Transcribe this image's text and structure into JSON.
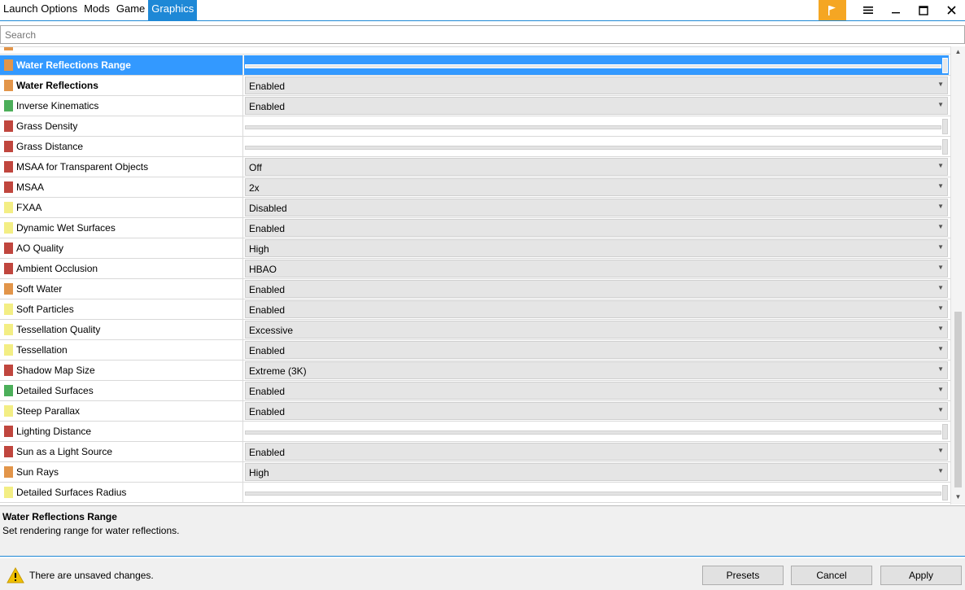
{
  "tabs": [
    {
      "label": "Launch Options",
      "active": false
    },
    {
      "label": "Mods",
      "active": false
    },
    {
      "label": "Game",
      "active": false
    },
    {
      "label": "Graphics",
      "active": true
    }
  ],
  "window_controls": [
    "flag-icon",
    "menu-icon",
    "minimize-icon",
    "maximize-icon",
    "close-icon"
  ],
  "search": {
    "placeholder": "Search",
    "value": ""
  },
  "colors": {
    "accent": "#1e88d6",
    "selected": "#3399ff",
    "flag": "#f5a623",
    "orange": "#e2954a",
    "green": "#4caf5a",
    "red": "#c0463e",
    "yellow": "#f3ee84"
  },
  "settings": [
    {
      "label": "Water Reflections Range",
      "color": "#e2954a",
      "type": "slider",
      "value": "",
      "selected": true,
      "bold": true
    },
    {
      "label": "Water Reflections",
      "color": "#e2954a",
      "type": "dropdown",
      "value": "Enabled",
      "bold": true
    },
    {
      "label": "Inverse Kinematics",
      "color": "#4caf5a",
      "type": "dropdown",
      "value": "Enabled"
    },
    {
      "label": "Grass Density",
      "color": "#c0463e",
      "type": "slider",
      "value": ""
    },
    {
      "label": "Grass Distance",
      "color": "#c0463e",
      "type": "slider",
      "value": ""
    },
    {
      "label": "MSAA for Transparent Objects",
      "color": "#c0463e",
      "type": "dropdown",
      "value": "Off"
    },
    {
      "label": "MSAA",
      "color": "#c0463e",
      "type": "dropdown",
      "value": "2x"
    },
    {
      "label": "FXAA",
      "color": "#f3ee84",
      "type": "dropdown",
      "value": "Disabled"
    },
    {
      "label": "Dynamic Wet Surfaces",
      "color": "#f3ee84",
      "type": "dropdown",
      "value": "Enabled"
    },
    {
      "label": "AO Quality",
      "color": "#c0463e",
      "type": "dropdown",
      "value": "High"
    },
    {
      "label": "Ambient Occlusion",
      "color": "#c0463e",
      "type": "dropdown",
      "value": "HBAO"
    },
    {
      "label": "Soft Water",
      "color": "#e2954a",
      "type": "dropdown",
      "value": "Enabled"
    },
    {
      "label": "Soft Particles",
      "color": "#f3ee84",
      "type": "dropdown",
      "value": "Enabled"
    },
    {
      "label": "Tessellation Quality",
      "color": "#f3ee84",
      "type": "dropdown",
      "value": "Excessive"
    },
    {
      "label": "Tessellation",
      "color": "#f3ee84",
      "type": "dropdown",
      "value": "Enabled"
    },
    {
      "label": "Shadow Map Size",
      "color": "#c0463e",
      "type": "dropdown",
      "value": "Extreme (3K)"
    },
    {
      "label": "Detailed Surfaces",
      "color": "#4caf5a",
      "type": "dropdown",
      "value": "Enabled"
    },
    {
      "label": "Steep Parallax",
      "color": "#f3ee84",
      "type": "dropdown",
      "value": "Enabled"
    },
    {
      "label": "Lighting Distance",
      "color": "#c0463e",
      "type": "slider",
      "value": ""
    },
    {
      "label": "Sun as a Light Source",
      "color": "#c0463e",
      "type": "dropdown",
      "value": "Enabled"
    },
    {
      "label": "Sun Rays",
      "color": "#e2954a",
      "type": "dropdown",
      "value": "High"
    },
    {
      "label": "Detailed Surfaces Radius",
      "color": "#f3ee84",
      "type": "slider",
      "value": ""
    }
  ],
  "description": {
    "title": "Water Reflections Range",
    "text": "Set rendering range for water reflections."
  },
  "footer": {
    "status": "There are unsaved changes.",
    "presets": "Presets",
    "cancel": "Cancel",
    "apply": "Apply"
  }
}
